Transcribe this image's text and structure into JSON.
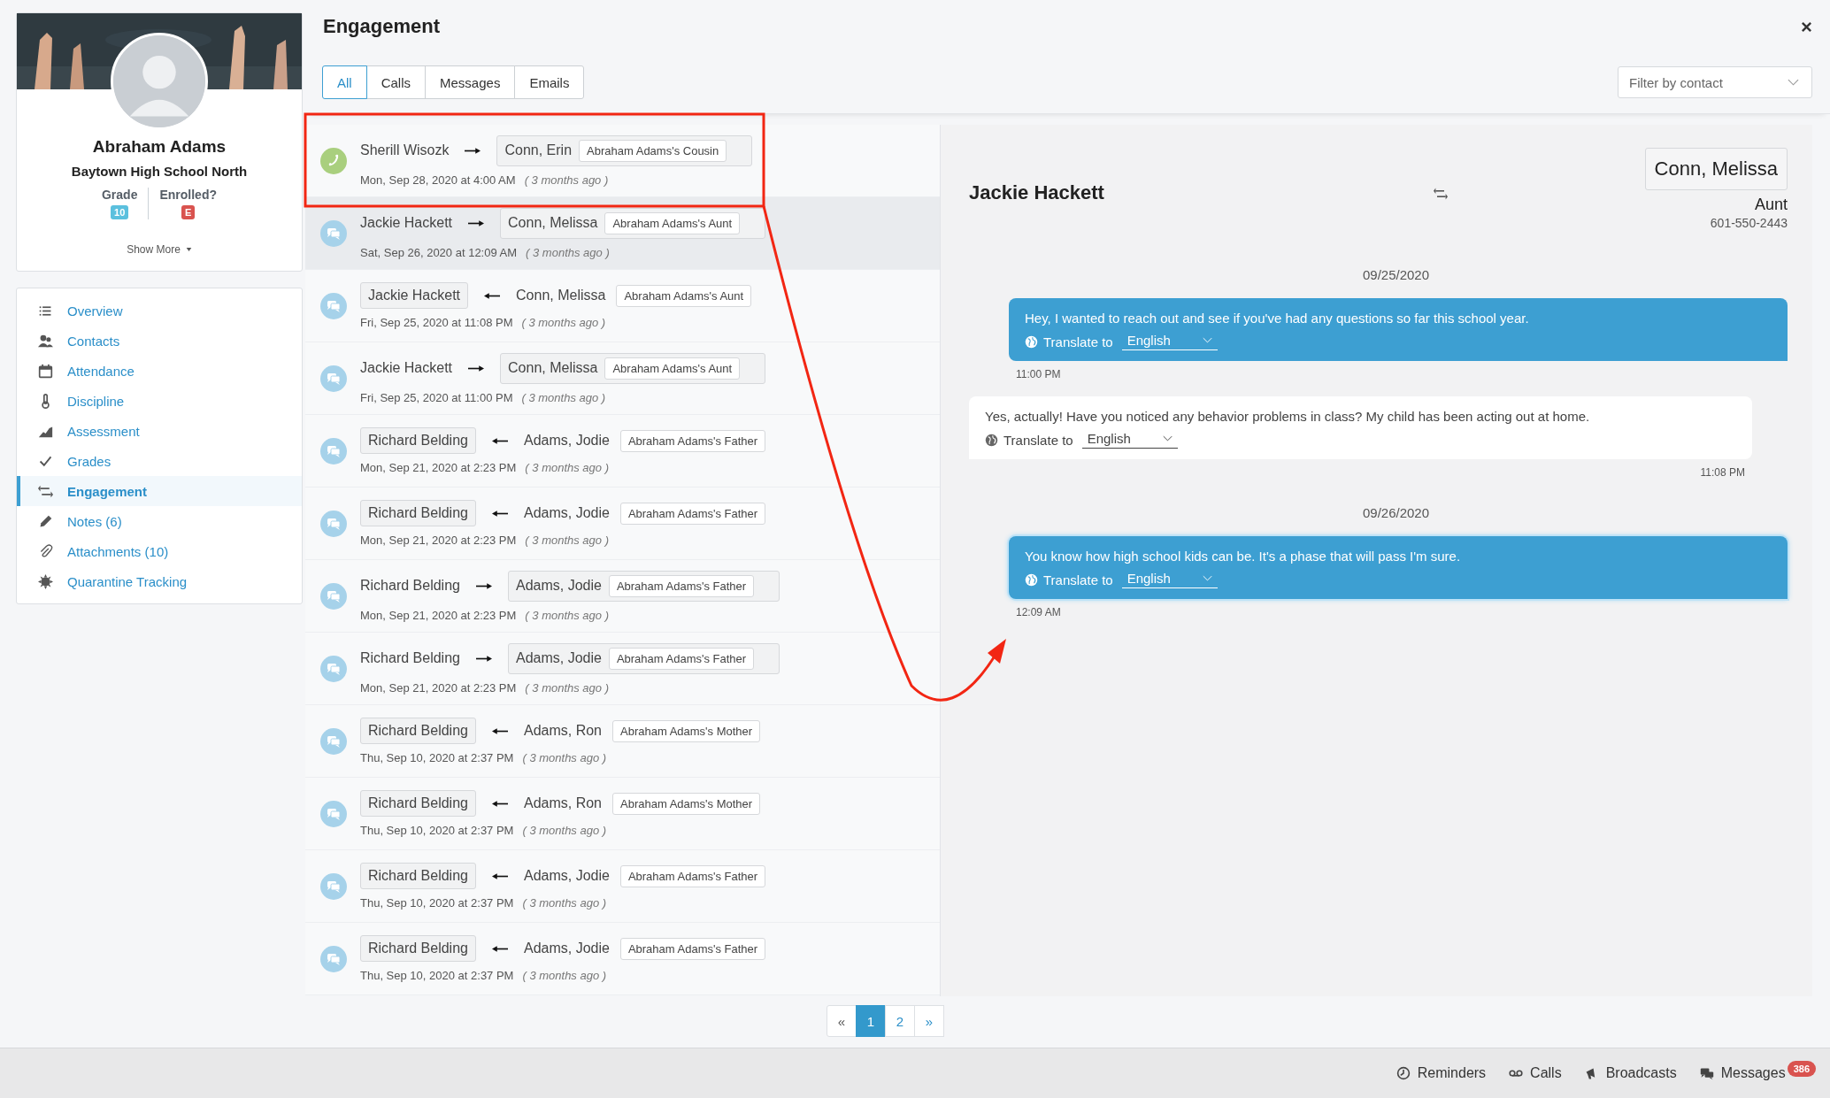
{
  "profile": {
    "name": "Abraham Adams",
    "school": "Baytown High School North",
    "grade_label": "Grade",
    "grade": "10",
    "enrolled_label": "Enrolled?",
    "enrolled": "E",
    "show_more": "Show More"
  },
  "nav": [
    {
      "label": "Overview",
      "selected": false
    },
    {
      "label": "Contacts",
      "selected": false
    },
    {
      "label": "Attendance",
      "selected": false
    },
    {
      "label": "Discipline",
      "selected": false
    },
    {
      "label": "Assessment",
      "selected": false
    },
    {
      "label": "Grades",
      "selected": false
    },
    {
      "label": "Engagement",
      "selected": true
    },
    {
      "label": "Notes (6)",
      "selected": false
    },
    {
      "label": "Attachments (10)",
      "selected": false
    },
    {
      "label": "Quarantine Tracking",
      "selected": false
    }
  ],
  "title": "Engagement",
  "tabs": [
    {
      "label": "All",
      "selected": true
    },
    {
      "label": "Calls",
      "selected": false
    },
    {
      "label": "Messages",
      "selected": false
    },
    {
      "label": "Emails",
      "selected": false
    }
  ],
  "filter": {
    "placeholder": "Filter by contact"
  },
  "rows": [
    {
      "kind": "call",
      "from": "Sherill Wisozk",
      "incoming": false,
      "contact": "Conn, Erin",
      "relation": "Abraham Adams's Cousin",
      "date": "Mon, Sep 28, 2020 at 4:00 AM",
      "ago": "( 3 months ago )",
      "selected": false
    },
    {
      "kind": "message",
      "from": "Jackie Hackett",
      "incoming": false,
      "contact": "Conn, Melissa",
      "relation": "Abraham Adams's Aunt",
      "date": "Sat, Sep 26, 2020 at 12:09 AM",
      "ago": "( 3 months ago )",
      "selected": true
    },
    {
      "kind": "message",
      "from": "Jackie Hackett",
      "incoming": true,
      "contact": "Conn, Melissa",
      "relation": "Abraham Adams's Aunt",
      "date": "Fri, Sep 25, 2020 at 11:08 PM",
      "ago": "( 3 months ago )",
      "selected": false
    },
    {
      "kind": "message",
      "from": "Jackie Hackett",
      "incoming": false,
      "contact": "Conn, Melissa",
      "relation": "Abraham Adams's Aunt",
      "date": "Fri, Sep 25, 2020 at 11:00 PM",
      "ago": "( 3 months ago )",
      "selected": false
    },
    {
      "kind": "message",
      "from": "Richard Belding",
      "incoming": true,
      "contact": "Adams, Jodie",
      "relation": "Abraham Adams's Father",
      "date": "Mon, Sep 21, 2020 at 2:23 PM",
      "ago": "( 3 months ago )",
      "selected": false
    },
    {
      "kind": "message",
      "from": "Richard Belding",
      "incoming": true,
      "contact": "Adams, Jodie",
      "relation": "Abraham Adams's Father",
      "date": "Mon, Sep 21, 2020 at 2:23 PM",
      "ago": "( 3 months ago )",
      "selected": false
    },
    {
      "kind": "message",
      "from": "Richard Belding",
      "incoming": false,
      "contact": "Adams, Jodie",
      "relation": "Abraham Adams's Father",
      "date": "Mon, Sep 21, 2020 at 2:23 PM",
      "ago": "( 3 months ago )",
      "selected": false
    },
    {
      "kind": "message",
      "from": "Richard Belding",
      "incoming": false,
      "contact": "Adams, Jodie",
      "relation": "Abraham Adams's Father",
      "date": "Mon, Sep 21, 2020 at 2:23 PM",
      "ago": "( 3 months ago )",
      "selected": false
    },
    {
      "kind": "message",
      "from": "Richard Belding",
      "incoming": true,
      "contact": "Adams, Ron",
      "relation": "Abraham Adams's Mother",
      "date": "Thu, Sep 10, 2020 at 2:37 PM",
      "ago": "( 3 months ago )",
      "selected": false
    },
    {
      "kind": "message",
      "from": "Richard Belding",
      "incoming": true,
      "contact": "Adams, Ron",
      "relation": "Abraham Adams's Mother",
      "date": "Thu, Sep 10, 2020 at 2:37 PM",
      "ago": "( 3 months ago )",
      "selected": false
    },
    {
      "kind": "message",
      "from": "Richard Belding",
      "incoming": true,
      "contact": "Adams, Jodie",
      "relation": "Abraham Adams's Father",
      "date": "Thu, Sep 10, 2020 at 2:37 PM",
      "ago": "( 3 months ago )",
      "selected": false
    },
    {
      "kind": "message",
      "from": "Richard Belding",
      "incoming": true,
      "contact": "Adams, Jodie",
      "relation": "Abraham Adams's Father",
      "date": "Thu, Sep 10, 2020 at 2:37 PM",
      "ago": "( 3 months ago )",
      "selected": false
    }
  ],
  "detail": {
    "staff": "Jackie Hackett",
    "contact": "Conn, Melissa",
    "relation": "Aunt",
    "phone": "601-550-2443",
    "messages": [
      {
        "kind": "date",
        "text": "09/25/2020"
      },
      {
        "kind": "sent",
        "text": "Hey, I wanted to reach out and see if you've had any questions so far this school year.",
        "translate": "Translate to",
        "language": "English",
        "time": "11:00 PM",
        "selected": false
      },
      {
        "kind": "received",
        "text": "Yes, actually! Have you noticed any behavior problems in class? My child has been acting out at home.",
        "translate": "Translate to",
        "language": "English",
        "time": "11:08 PM",
        "selected": false
      },
      {
        "kind": "date",
        "text": "09/26/2020"
      },
      {
        "kind": "sent",
        "text": "You know how high school kids can be. It's a phase that will pass I'm sure.",
        "translate": "Translate to",
        "language": "English",
        "time": "12:09 AM",
        "selected": true
      }
    ]
  },
  "pagination": {
    "prev": "«",
    "pages": [
      {
        "label": "1",
        "selected": true
      },
      {
        "label": "2",
        "selected": false
      }
    ],
    "next": "»"
  },
  "footer": [
    {
      "label": "Reminders"
    },
    {
      "label": "Calls"
    },
    {
      "label": "Broadcasts"
    },
    {
      "label": "Messages",
      "badge": "386"
    }
  ]
}
